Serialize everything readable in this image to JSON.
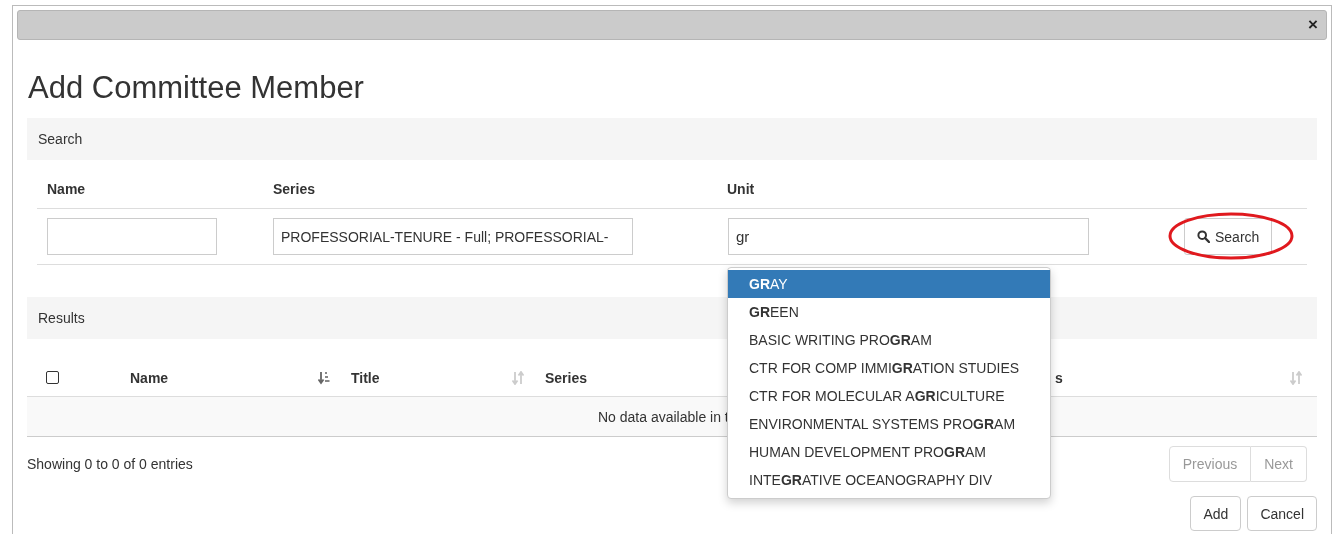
{
  "dialog": {
    "close": "×",
    "title": "Add Committee Member"
  },
  "search_panel": {
    "heading": "Search",
    "fields": [
      {
        "label": "Name"
      },
      {
        "label": "Series",
        "value": "PROFESSORIAL-TENURE - Full; PROFESSORIAL-"
      },
      {
        "label": "Unit",
        "value": "gr"
      }
    ],
    "button": "Search",
    "highlighted": true
  },
  "unit_suggestions": [
    {
      "label": "**GR**AY",
      "selected": true
    },
    {
      "label": "**GR**EEN",
      "selected": false
    },
    {
      "label": "BASIC WRITING PRO**GR**AM",
      "selected": false
    },
    {
      "label": "CTR FOR COMP IMMI**GR**ATION STUDIES",
      "selected": false
    },
    {
      "label": "CTR FOR MOLECULAR A**GR**ICULTURE",
      "selected": false
    },
    {
      "label": "ENVIRONMENTAL SYSTEMS PRO**GR**AM",
      "selected": false
    },
    {
      "label": "HUMAN DEVELOPMENT PRO**GR**AM",
      "selected": false
    },
    {
      "label": "INTE**GR**ATIVE OCEANOGRAPHY DIV",
      "selected": false
    }
  ],
  "results_panel": {
    "heading": "Results",
    "select_all_checked": false,
    "columns": [
      {
        "label": "Name",
        "sorted": true
      },
      {
        "label": "Title",
        "sorted": false
      },
      {
        "label": "Series"
      },
      {
        "label": "s",
        "sorted": false
      }
    ],
    "empty_text": "No data available in t",
    "info": "Showing 0 to 0 of 0 entries",
    "pagination": [
      {
        "label": "Previous",
        "disabled": true
      },
      {
        "label": "Next",
        "disabled": true
      }
    ]
  },
  "buttons": [
    "Add",
    "Cancel"
  ]
}
